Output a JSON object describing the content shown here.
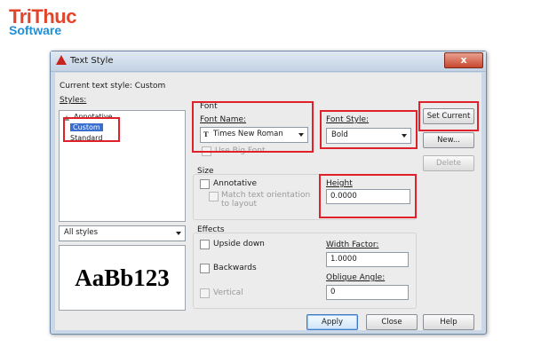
{
  "brand": {
    "line1": "TriThuc",
    "line2": "Software"
  },
  "window": {
    "title": "Text Style"
  },
  "current_style": {
    "text": "Current text style:  Custom"
  },
  "styles": {
    "label": "Styles:",
    "items": [
      {
        "label": "Annotative",
        "icon": "annotative-icon"
      },
      {
        "label": "Custom",
        "selected": true
      },
      {
        "label": "Standard"
      }
    ],
    "filter": "All styles"
  },
  "preview": {
    "text": "AaBb123"
  },
  "font": {
    "group_label": "Font",
    "name_label": "Font Name:",
    "name_value": "Times New Roman",
    "name_icon": "truetype-font-icon",
    "style_label": "Font Style:",
    "style_value": "Bold",
    "big_font_label": "Use Big Font"
  },
  "size": {
    "group_label": "Size",
    "annotative_label": "Annotative",
    "match_label_1": "Match text orientation",
    "match_label_2": "to layout",
    "height_label": "Height",
    "height_value": "0.0000"
  },
  "effects": {
    "group_label": "Effects",
    "upside_down": "Upside down",
    "backwards": "Backwards",
    "vertical": "Vertical",
    "width_factor_label": "Width Factor:",
    "width_factor_value": "1.0000",
    "oblique_label": "Oblique Angle:",
    "oblique_value": "0"
  },
  "buttons": {
    "set_current": "Set Current",
    "new": "New...",
    "delete": "Delete",
    "apply": "Apply",
    "close": "Close",
    "help": "Help",
    "close_x": "x"
  },
  "colors": {
    "highlight": "#e0212b",
    "selection": "#3a6fd0"
  }
}
